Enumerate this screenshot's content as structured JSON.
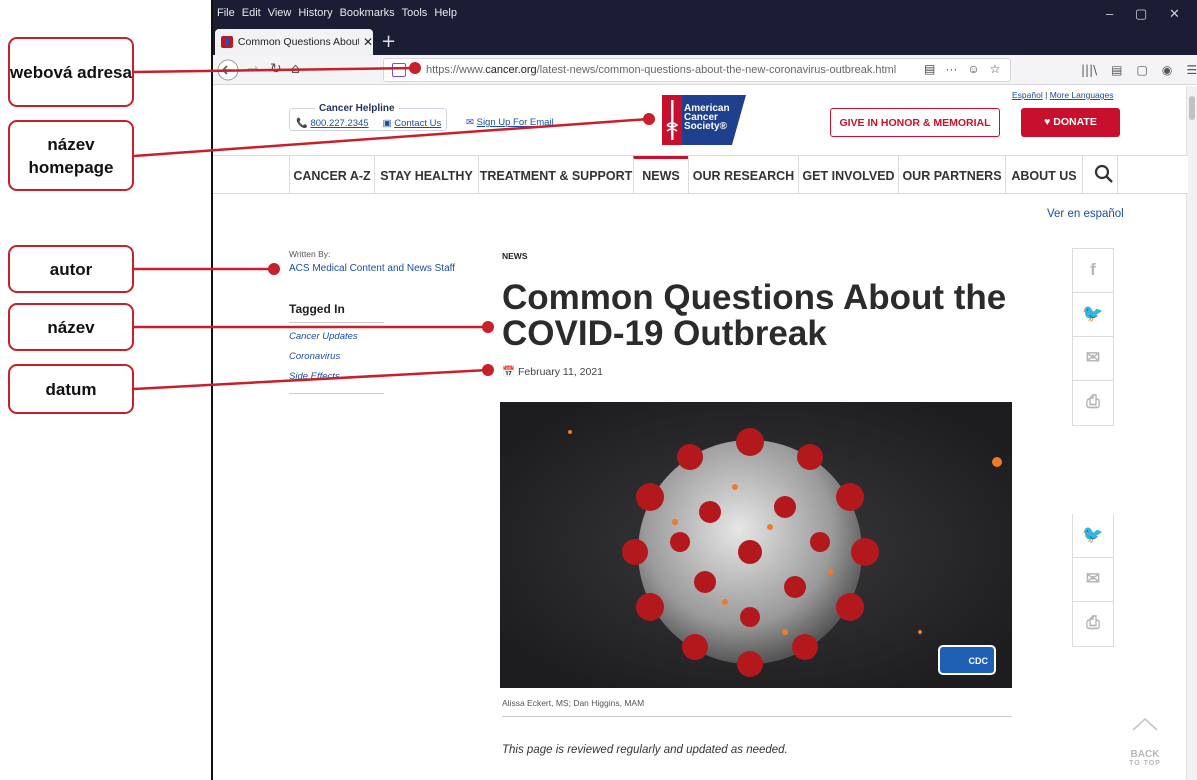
{
  "callouts": [
    {
      "id": "web-address",
      "label": "webová adresa"
    },
    {
      "id": "homepage-name",
      "label": "název homepage"
    },
    {
      "id": "author",
      "label": "autor"
    },
    {
      "id": "title",
      "label": "název"
    },
    {
      "id": "date",
      "label": "datum"
    }
  ],
  "browser": {
    "menu": [
      "File",
      "Edit",
      "View",
      "History",
      "Bookmarks",
      "Tools",
      "Help"
    ],
    "window_controls": [
      "–",
      "▢",
      "✕"
    ],
    "tab_title": "Common Questions About the",
    "tab_close": "✕",
    "new_tab": "+",
    "url_prefix": "https://www.",
    "url_domain": "cancer.org",
    "url_path": "/latest-news/common-questions-about-the-new-coronavirus-outbreak.html",
    "url_icons": [
      "▤",
      "···",
      "☺",
      "☆"
    ],
    "toolbar_icons": [
      "|||\\",
      "▤",
      "▢",
      "◉",
      "☰"
    ]
  },
  "site": {
    "helpline_title": "Cancer Helpline",
    "phone": "800.227.2345",
    "contact": "Contact Us",
    "signup": "Sign Up For Email",
    "logo_lines": [
      "American",
      "Cancer",
      "Society®"
    ],
    "lang_espanol": "Español",
    "lang_sep": "|",
    "lang_more": "More Languages",
    "honor_btn": "GIVE IN HONOR & MEMORIAL",
    "donate_btn": "DONATE",
    "nav": [
      "CANCER A-Z",
      "STAY HEALTHY",
      "TREATMENT & SUPPORT",
      "NEWS",
      "OUR RESEARCH",
      "GET INVOLVED",
      "OUR PARTNERS",
      "ABOUT US"
    ],
    "active_nav": "NEWS",
    "ver_espanol": "Ver en español"
  },
  "article": {
    "written_by_label": "Written By:",
    "author": "ACS Medical Content and News Staff",
    "tagged_in": "Tagged In",
    "tags": [
      "Cancer Updates",
      "Coronavirus",
      "Side Effects"
    ],
    "kicker": "NEWS",
    "headline": "Common Questions About the COVID-19 Outbreak",
    "date": "February 11, 2021",
    "cdc_badge": "CDC",
    "caption": "Alissa Eckert, MS; Dan Higgins, MAM",
    "reviewed_note": "This page is reviewed regularly and updated as needed.",
    "back_to_top": [
      "BACK",
      "TO TOP"
    ]
  },
  "share_icons": [
    "f",
    "twitter",
    "mail",
    "print"
  ],
  "colors": {
    "brand_red": "#c8102e",
    "link_blue": "#1b4ea0",
    "browser_dark": "#1b1d35",
    "callout_red": "#c8202a"
  }
}
